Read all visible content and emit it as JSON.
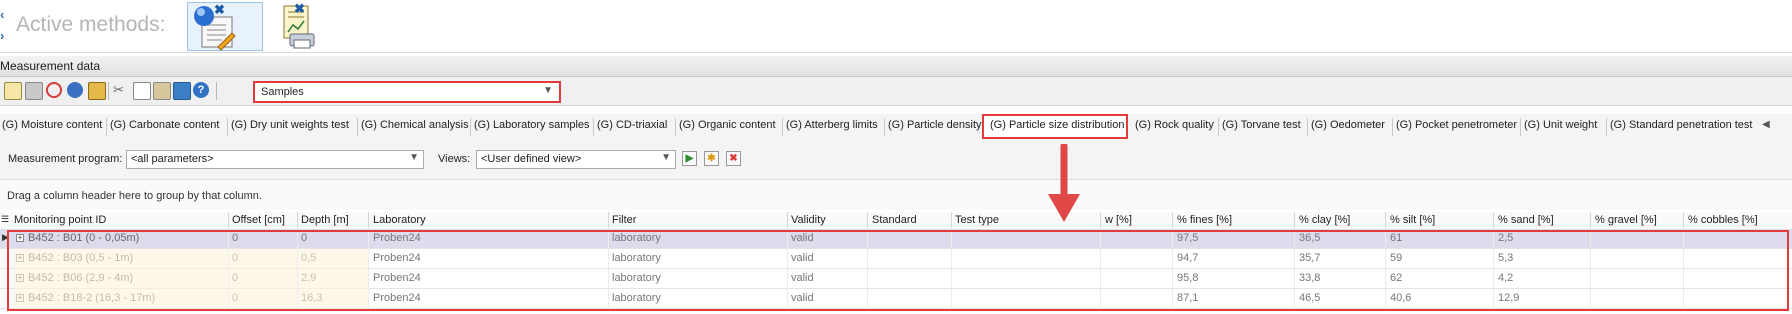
{
  "active_methods": {
    "label": "Active methods:",
    "methods": [
      {
        "icon": "globe-document-icon",
        "close_icon": "close-icon"
      },
      {
        "icon": "report-printer-icon",
        "close_icon": "close-icon"
      }
    ]
  },
  "panel_title": "Measurement data",
  "toolbar": {
    "icons": [
      "new-document-icon",
      "save-icon",
      "cancel-icon",
      "refresh-icon",
      "export-icon",
      "cut-icon",
      "copy-icon",
      "paste-icon",
      "image-icon",
      "help-icon"
    ],
    "data_source": "Samples"
  },
  "tabs": [
    "(G) Moisture content",
    "(G) Carbonate content",
    "(G) Dry unit weights test",
    "(G) Chemical analysis",
    "(G) Laboratory samples",
    "(G) CD-triaxial",
    "(G) Organic content",
    "(G) Atterberg limits",
    "(G) Particle density",
    "(G) Particle size distribution",
    "(G) Rock quality",
    "(G) Torvane test",
    "(G) Oedometer",
    "(G) Pocket penetrometer",
    "(G) Unit weight",
    "(G) Standard penetration test"
  ],
  "active_tab": "(G) Particle size distribution",
  "filters": {
    "program_label": "Measurement program:",
    "program_value": "<all parameters>",
    "views_label": "Views:",
    "views_value": "<User defined view>"
  },
  "group_hint": "Drag a column header here to group by that column.",
  "columns": [
    "Monitoring point ID",
    "Offset [cm]",
    "Depth [m]",
    "Laboratory",
    "Filter",
    "Validity",
    "Standard",
    "Test type",
    "w [%]",
    "% fines [%]",
    "% clay [%]",
    "% silt [%]",
    "% sand [%]",
    "% gravel [%]",
    "% cobbles [%]"
  ],
  "rows": [
    {
      "id": "B452 : B01 (0 - 0,05m)",
      "offset": "0",
      "depth": "0",
      "lab": "Proben24",
      "filter": "laboratory",
      "validity": "valid",
      "standard": "",
      "test_type": "",
      "w": "",
      "fines": "97,5",
      "clay": "36,5",
      "silt": "61",
      "sand": "2,5",
      "gravel": "",
      "cobbles": ""
    },
    {
      "id": "B452 : B03 (0,5 - 1m)",
      "offset": "0",
      "depth": "0,5",
      "lab": "Proben24",
      "filter": "laboratory",
      "validity": "valid",
      "standard": "",
      "test_type": "",
      "w": "",
      "fines": "94,7",
      "clay": "35,7",
      "silt": "59",
      "sand": "5,3",
      "gravel": "",
      "cobbles": ""
    },
    {
      "id": "B452 : B06 (2,9 - 4m)",
      "offset": "0",
      "depth": "2,9",
      "lab": "Proben24",
      "filter": "laboratory",
      "validity": "valid",
      "standard": "",
      "test_type": "",
      "w": "",
      "fines": "95,8",
      "clay": "33,8",
      "silt": "62",
      "sand": "4,2",
      "gravel": "",
      "cobbles": ""
    },
    {
      "id": "B452 : B18-2 (16,3 - 17m)",
      "offset": "0",
      "depth": "16,3",
      "lab": "Proben24",
      "filter": "laboratory",
      "validity": "valid",
      "standard": "",
      "test_type": "",
      "w": "",
      "fines": "87,1",
      "clay": "46,5",
      "silt": "40,6",
      "sand": "12,9",
      "gravel": "",
      "cobbles": ""
    }
  ],
  "colors": {
    "highlight": "#e33b3b",
    "row_selected": "#dcdcec",
    "row_alt": "#fdf3dc"
  }
}
